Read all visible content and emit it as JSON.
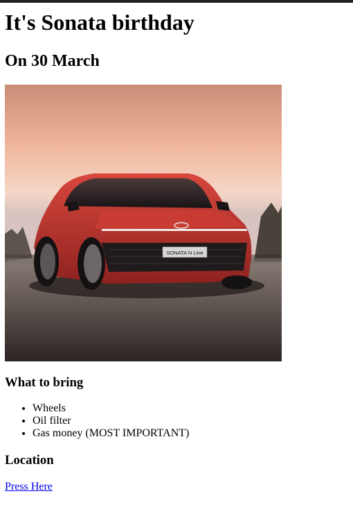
{
  "title": "It's Sonata birthday",
  "date_heading": "On 30 March",
  "car_badge": "SONATA N Line",
  "bring_heading": "What to bring",
  "bring_items": [
    "Wheels",
    "Oil filter",
    "Gas money (MOST IMPORTANT)"
  ],
  "location_heading": "Location",
  "location_link": "Press Here",
  "colors": {
    "link": "#0000ee",
    "car_body": "#b8322c",
    "sky": "#e7a892"
  }
}
